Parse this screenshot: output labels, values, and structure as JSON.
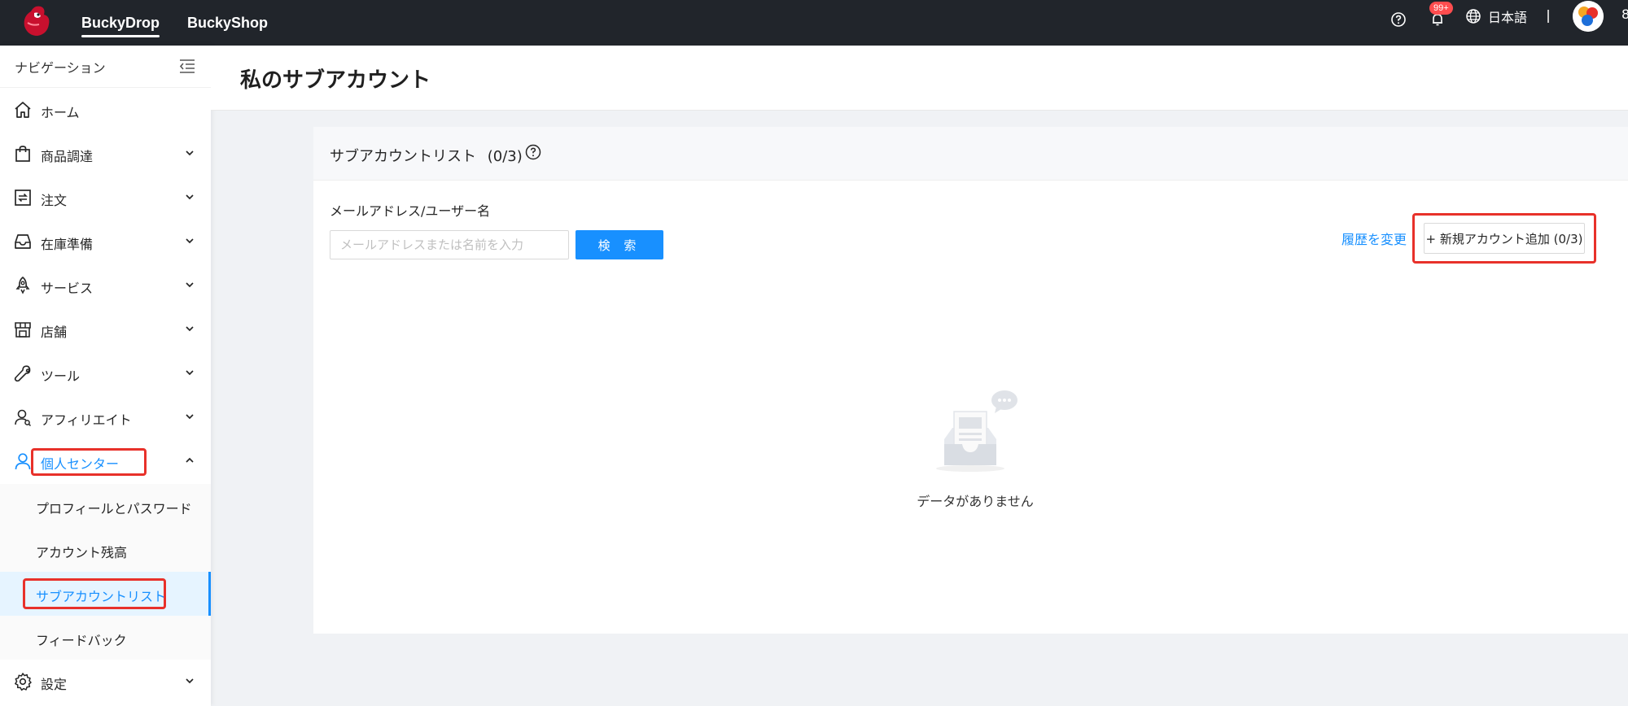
{
  "topbar": {
    "tabs": [
      {
        "label": "BuckyDrop",
        "active": true
      },
      {
        "label": "BuckyShop",
        "active": false
      }
    ],
    "notification_badge": "99+",
    "language": "日本語",
    "edge_char": "8",
    "bg_color": "#21252b"
  },
  "sidebar": {
    "header": "ナビゲーション",
    "items": [
      {
        "label": "ホーム",
        "icon": "home-icon"
      },
      {
        "label": "商品調達",
        "icon": "shopping-bag-icon"
      },
      {
        "label": "注文",
        "icon": "order-icon"
      },
      {
        "label": "在庫準備",
        "icon": "inbox-icon"
      },
      {
        "label": "サービス",
        "icon": "rocket-icon"
      },
      {
        "label": "店舗",
        "icon": "store-icon"
      },
      {
        "label": "ツール",
        "icon": "wrench-icon"
      },
      {
        "label": "アフィリエイト",
        "icon": "affiliate-icon"
      },
      {
        "label": "個人センター",
        "icon": "user-icon",
        "open": true
      },
      {
        "label": "設定",
        "icon": "gear-icon"
      }
    ],
    "submenu": [
      {
        "label": "プロフィールとパスワード"
      },
      {
        "label": "アカウント残高"
      },
      {
        "label": "サブアカウントリスト",
        "active": true
      },
      {
        "label": "フィードバック"
      }
    ]
  },
  "main": {
    "page_title": "私のサブアカウント",
    "card_title": "サブアカウントリスト",
    "card_count": "(0/3)",
    "search_label": "メールアドレス/ユーザー名",
    "search_placeholder": "メールアドレスまたは名前を入力",
    "search_value": "",
    "search_button": "検 索",
    "history_link": "履歴を変更",
    "add_button": "+ 新規アカウント追加 (0/3)",
    "empty_text": "データがありません"
  },
  "colors": {
    "accent": "#1890ff",
    "highlight": "#e8312a",
    "badge": "#ff4d4f"
  }
}
